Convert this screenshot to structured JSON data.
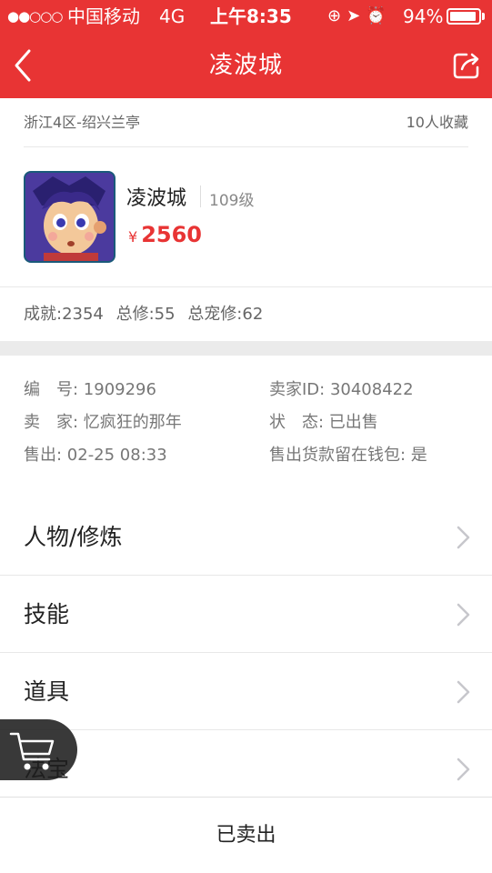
{
  "status_bar": {
    "signal": "●●○○○",
    "carrier": "中国移动",
    "network": "4G",
    "time": "上午8:35",
    "battery": "94%"
  },
  "nav": {
    "title": "凌波城"
  },
  "listing": {
    "region": "浙江4区-绍兴兰亭",
    "favorites": "10人收藏",
    "name": "凌波城",
    "level": "109级",
    "currency": "¥",
    "price": "2560",
    "achievement": "成就:2354",
    "cultivation": "总修:55",
    "pet_cultivation": "总宠修:62"
  },
  "details": {
    "id": "编　号: 1909296",
    "seller_id": "卖家ID: 30408422",
    "seller": "卖　家: 忆疯狂的那年",
    "status": "状　态: 已出售",
    "sold_at": "售出: 02-25 08:33",
    "wallet": "售出货款留在钱包: 是"
  },
  "menu": [
    {
      "label": "人物/修炼"
    },
    {
      "label": "技能"
    },
    {
      "label": "道具"
    },
    {
      "label": "法宝"
    }
  ],
  "bottom": {
    "label": "已卖出"
  },
  "colors": {
    "brand": "#e83434"
  }
}
